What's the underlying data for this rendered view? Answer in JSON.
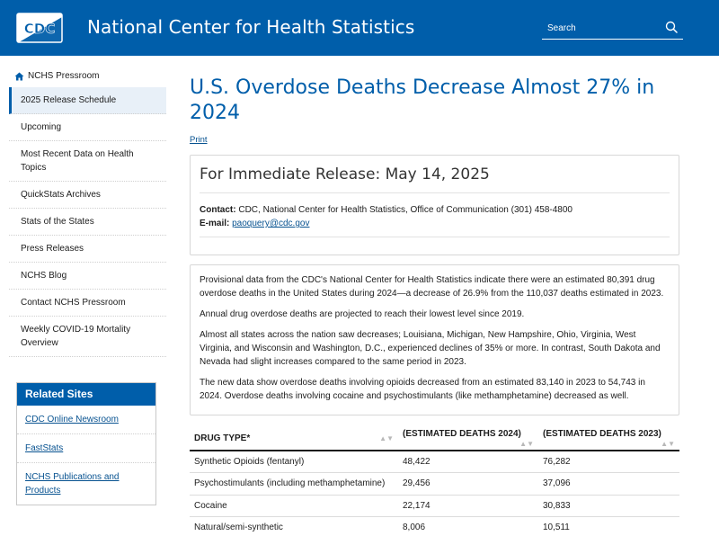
{
  "header": {
    "logo_text": "CDC",
    "title": "National Center for Health Statistics",
    "search_placeholder": "Search"
  },
  "sidebar": {
    "home_label": "NCHS Pressroom",
    "items": [
      {
        "label": "2025 Release Schedule"
      },
      {
        "label": "Upcoming"
      },
      {
        "label": "Most Recent Data on Health Topics"
      },
      {
        "label": "QuickStats Archives"
      },
      {
        "label": "Stats of the States"
      },
      {
        "label": "Press Releases"
      },
      {
        "label": "NCHS Blog"
      },
      {
        "label": "Contact NCHS Pressroom"
      },
      {
        "label": "Weekly COVID-19 Mortality Overview"
      }
    ],
    "related": {
      "title": "Related Sites",
      "links": [
        {
          "label": "CDC Online Newsroom"
        },
        {
          "label": "FastStats"
        },
        {
          "label": "NCHS Publications and Products"
        }
      ]
    }
  },
  "main": {
    "title": "U.S. Overdose Deaths Decrease Almost 27% in 2024",
    "print_label": "Print",
    "release": {
      "title": "For Immediate Release: May 14, 2025",
      "contact_label": "Contact:",
      "contact_value": "CDC, National Center for Health Statistics, Office of Communication (301) 458-4800",
      "email_label": "E-mail:",
      "email_value": "paoquery@cdc.gov"
    },
    "paragraphs": [
      "Provisional data from the CDC's National Center for Health Statistics indicate there were an estimated 80,391 drug overdose deaths in the United States during 2024—a decrease of 26.9% from the 110,037 deaths estimated in 2023.",
      "Annual drug overdose deaths are projected to reach their lowest level since 2019.",
      "Almost all states across the nation saw decreases; Louisiana, Michigan, New Hampshire, Ohio, Virginia, West Virginia, and Wisconsin and Washington, D.C., experienced declines of 35% or more. In contrast, South Dakota and Nevada had slight increases compared to the same period in 2023.",
      "The new data show overdose deaths involving opioids decreased from an estimated 83,140 in 2023 to 54,743 in 2024. Overdose deaths involving cocaine and psychostimulants (like methamphetamine) decreased as well."
    ],
    "table": {
      "headers": [
        "DRUG TYPE*",
        "(ESTIMATED DEATHS 2024)",
        "(ESTIMATED DEATHS 2023)"
      ],
      "rows": [
        [
          "Synthetic Opioids (fentanyl)",
          "48,422",
          "76,282"
        ],
        [
          "Psychostimulants (including methamphetamine)",
          "29,456",
          "37,096"
        ],
        [
          "Cocaine",
          "22,174",
          "30,833"
        ],
        [
          "Natural/semi-synthetic",
          "8,006",
          "10,511"
        ]
      ]
    }
  },
  "colors": {
    "brand": "#005eaa",
    "link": "#075290"
  }
}
